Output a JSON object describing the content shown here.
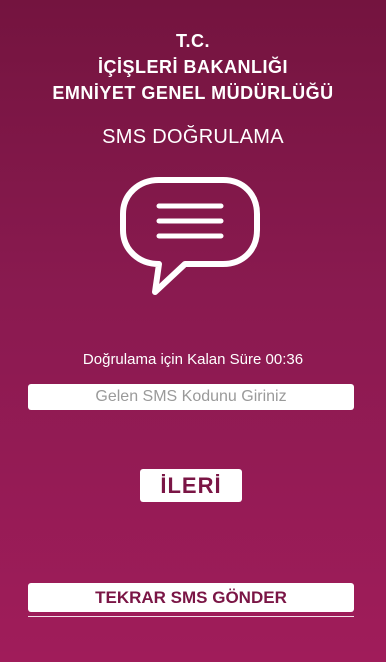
{
  "header": {
    "line1": "T.C.",
    "line2": "İÇİŞLERİ BAKANLIĞI",
    "line3": "EMNİYET GENEL MÜDÜRLÜĞÜ"
  },
  "subtitle": "SMS DOĞRULAMA",
  "icon": "chat-bubble-icon",
  "countdown": {
    "text": "Doğrulama için Kalan Süre 00:36"
  },
  "sms_input": {
    "placeholder": "Gelen SMS Kodunu Giriniz",
    "value": ""
  },
  "next_button": "İLERİ",
  "resend_button": "TEKRAR SMS GÖNDER",
  "colors": {
    "background_top": "#74143f",
    "background_bottom": "#a01c5a",
    "button_text": "#7a1545"
  }
}
